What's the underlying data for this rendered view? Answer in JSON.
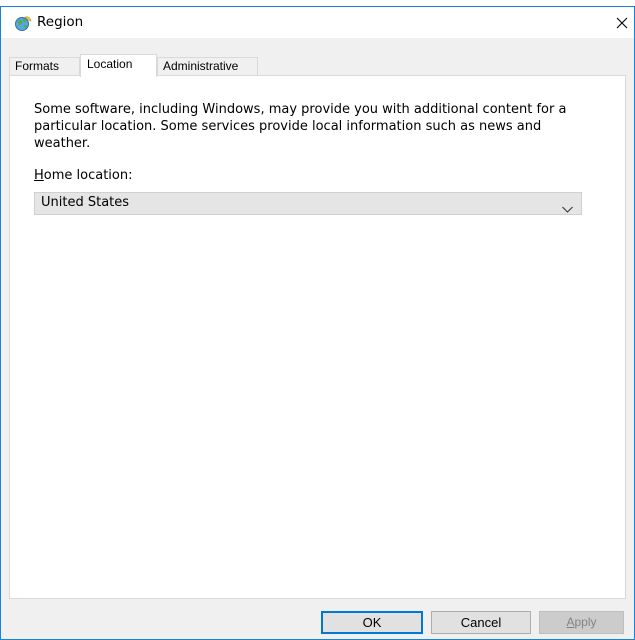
{
  "window": {
    "title": "Region",
    "icon": "globe-region-icon",
    "close_icon": "close-icon",
    "accent_color": "#0078d7"
  },
  "tabs": [
    {
      "label": "Formats",
      "active": false
    },
    {
      "label": "Location",
      "active": true
    },
    {
      "label": "Administrative",
      "active": false
    }
  ],
  "location": {
    "description": "Some software, including Windows, may provide you with additional content for a particular location. Some services provide local information such as news and weather.",
    "home_label_accel": "H",
    "home_label_rest": "ome location:",
    "home_value": "United States",
    "dropdown_icon": "chevron-down-icon"
  },
  "buttons": {
    "ok": "OK",
    "cancel": "Cancel",
    "apply_accel": "A",
    "apply_rest": "pply"
  }
}
